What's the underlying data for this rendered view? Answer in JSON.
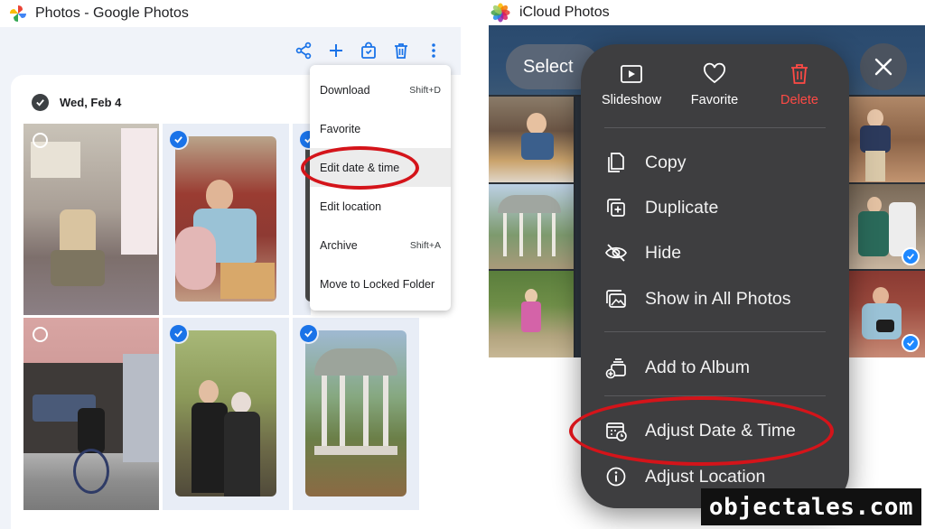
{
  "google_photos": {
    "window_title": "Photos - Google Photos",
    "toolbar_icons": [
      "share-icon",
      "add-icon",
      "shopping-bag-icon",
      "trash-icon",
      "more-vert-icon"
    ],
    "date_label": "Wed, Feb 4",
    "menu": [
      {
        "label": "Download",
        "shortcut": "Shift+D"
      },
      {
        "label": "Favorite",
        "shortcut": ""
      },
      {
        "label": "Edit date & time",
        "shortcut": ""
      },
      {
        "label": "Edit location",
        "shortcut": ""
      },
      {
        "label": "Archive",
        "shortcut": "Shift+A"
      },
      {
        "label": "Move to Locked Folder",
        "shortcut": ""
      }
    ],
    "accent": "#1a73e8"
  },
  "icloud": {
    "window_title": "iCloud Photos",
    "select_label": "Select",
    "top_actions": [
      {
        "label": "Slideshow",
        "icon": "slideshow-icon"
      },
      {
        "label": "Favorite",
        "icon": "heart-icon"
      },
      {
        "label": "Delete",
        "icon": "trash-icon"
      }
    ],
    "menu": [
      {
        "label": "Copy",
        "icon": "copy-icon"
      },
      {
        "label": "Duplicate",
        "icon": "duplicate-icon"
      },
      {
        "label": "Hide",
        "icon": "eye-slash-icon"
      },
      {
        "label": "Show in All Photos",
        "icon": "photos-icon"
      },
      {
        "label": "Add to Album",
        "icon": "add-album-icon"
      },
      {
        "label": "Adjust Date & Time",
        "icon": "calendar-clock-icon"
      },
      {
        "label": "Adjust Location",
        "icon": "info-icon"
      }
    ],
    "delete_color": "#ff4a45"
  },
  "watermark": "objectales.com"
}
